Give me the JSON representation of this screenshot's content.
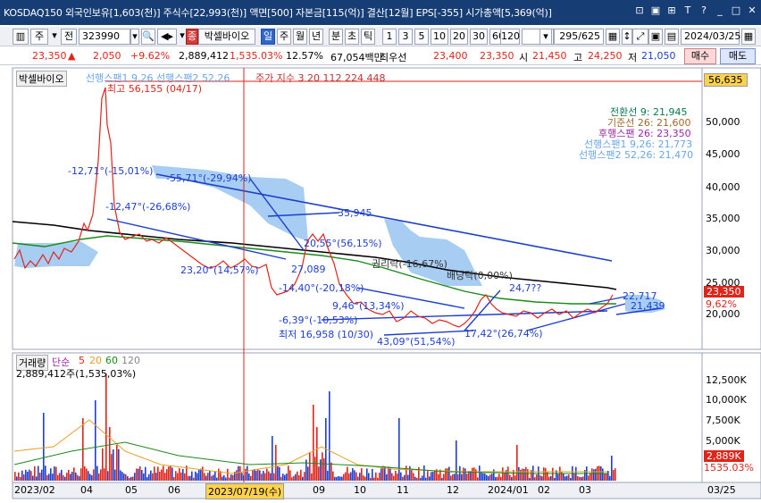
{
  "window": {
    "title": "KOSDAQ150 외국인보유[1,603(천)] 주식수[22,993(천)] 액면[500] 자본금[115(억)] 결산[12월] EPS[-355] 시가총액[5,369(억)]",
    "buttons": [
      "⊡",
      "▣",
      "⊞",
      "T",
      "?",
      "_",
      "□",
      "✕"
    ]
  },
  "toolbar": {
    "market_type": "주",
    "prefix": "전",
    "code": "323990",
    "stock_badge": "종",
    "stock_name": "박셀바이오",
    "period_buttons": [
      "일",
      "주",
      "월",
      "년",
      "분",
      "초",
      "틱"
    ],
    "active_period": "일",
    "intervals": [
      "1",
      "3",
      "5",
      "10",
      "20",
      "30",
      "60",
      "120"
    ],
    "page_counter": "295/625",
    "date": "2024/03/25"
  },
  "quote": {
    "price": "23,350",
    "change_arrow": "▲",
    "change": "2,050",
    "change_pct": "+9.62%",
    "volume": "2,889,412",
    "volume_pct": "1,535.03%",
    "turnover_pct": "12.57%",
    "amount": "67,054백만",
    "priority_label": "최우선",
    "ask": "23,400",
    "bid": "23,350",
    "open_label": "시",
    "open": "21,450",
    "high_label": "고",
    "high": "24,250",
    "low_label": "저",
    "low": "21,050",
    "buy_label": "매수",
    "sell_label": "매도"
  },
  "chart": {
    "price_header": {
      "name": "박셀바이오",
      "ichimoku": "선행스팬1 9,26  선행스팬2 52,26",
      "ma": "주가 지수 3  20  112  224  448"
    },
    "right_top_value": "56,635",
    "y_ticks": [
      "50,000",
      "45,000",
      "40,000",
      "35,000",
      "30,000",
      "25,000",
      "20,000"
    ],
    "right_price_label": "23,350",
    "right_change_label": "9,62%",
    "legend": [
      {
        "label": "전환선 9: 21,945",
        "color": "#0a7a4a"
      },
      {
        "label": "기준선 26: 21,600",
        "color": "#a06a2a"
      },
      {
        "label": "후행스팬 26: 23,350",
        "color": "#9b27a8"
      },
      {
        "label": "선행스팬1 9,26: 21,773",
        "color": "#6aa6e8"
      },
      {
        "label": "선행스팬2 52,26: 21,470",
        "color": "#6aa6e8"
      }
    ],
    "annotations": {
      "high": "최고 56,155 (04/17)",
      "low": "최저 16,958 (10/30)",
      "a1": "-12,71°(-15,01%)",
      "a2": "-12,47°(-26,68%)",
      "a3": "-55,71°(-29,94%)",
      "a4": "35,945",
      "a5": "23,20°(14,57%)",
      "a6": "27,089",
      "a7": "20,55°(56,15%)",
      "a8": "권리락(-16,67%)",
      "a9": "배당락(0,00%)",
      "a10": "-14,40°(-20,18%)",
      "a11": "9,46°(13,34%)",
      "a12": "-6,39°(-10,53%)",
      "a13": "43,09°(51,54%)",
      "a14": "22,717",
      "a15": "21,439",
      "a16": "24,7??",
      "a17": "17,42°(26,74%)"
    },
    "volume": {
      "title": "거래량",
      "ma_label": "단순",
      "ma5": "5",
      "ma20": "20",
      "ma60": "60",
      "ma120": "120",
      "amount": "2,889,412주(1,535,03%)",
      "ticks": [
        "12,500K",
        "10,000K",
        "7,500K",
        "5,000K"
      ],
      "right_value": "2,889K",
      "right_pct": "1535.03%"
    },
    "x_labels": [
      "2023/02",
      "04",
      "05",
      "06",
      "2023/07/19(수)",
      "09",
      "10",
      "11",
      "12",
      "2024/01",
      "02",
      "03",
      "03/25"
    ]
  },
  "colors": {
    "up": "#e0241a",
    "down": "#1d3fcf",
    "cloud": "#9fc8f2",
    "ma_black": "#000000",
    "ma_green": "#1a8a1a",
    "titlebar": "#163d74"
  }
}
